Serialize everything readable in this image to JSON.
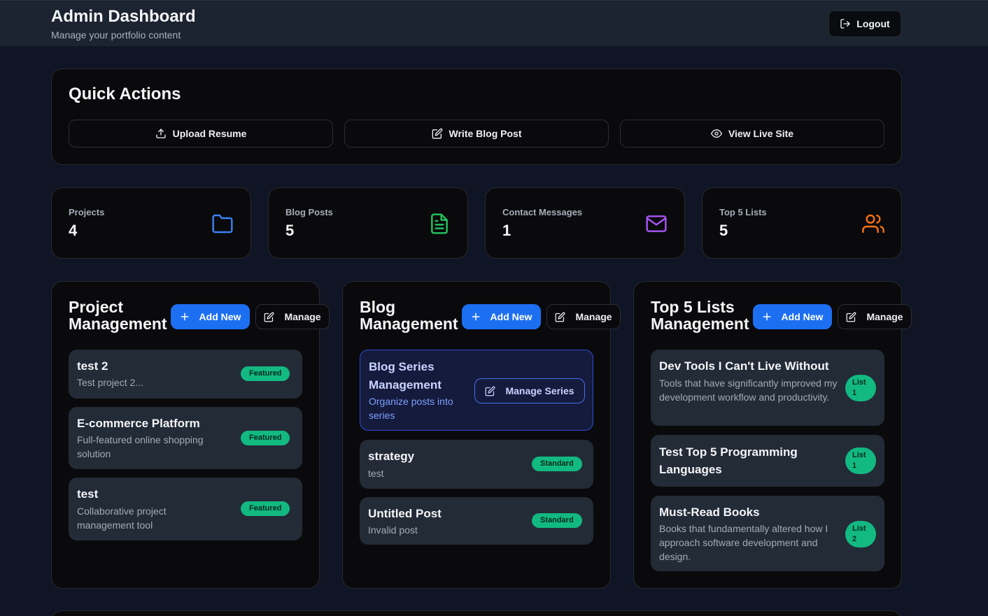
{
  "header": {
    "title": "Admin Dashboard",
    "subtitle": "Manage your portfolio content",
    "logout_label": "Logout"
  },
  "quick_actions": {
    "title": "Quick Actions",
    "buttons": [
      {
        "label": "Upload Resume",
        "icon": "upload-icon"
      },
      {
        "label": "Write Blog Post",
        "icon": "edit-icon"
      },
      {
        "label": "View Live Site",
        "icon": "eye-icon"
      }
    ]
  },
  "stats": [
    {
      "label": "Projects",
      "value": "4",
      "icon": "folder-icon",
      "color": "#3b82f6"
    },
    {
      "label": "Blog Posts",
      "value": "5",
      "icon": "file-text-icon",
      "color": "#22c55e"
    },
    {
      "label": "Contact Messages",
      "value": "1",
      "icon": "mail-icon",
      "color": "#a855f7"
    },
    {
      "label": "Top 5 Lists",
      "value": "5",
      "icon": "users-icon",
      "color": "#f97316"
    }
  ],
  "panels": {
    "projects": {
      "title_line1": "Project",
      "title_line2": "Management",
      "add_label": "Add New",
      "manage_label": "Manage",
      "items": [
        {
          "title": "test 2",
          "desc": "Test project 2...",
          "badge": "Featured"
        },
        {
          "title": "E-commerce Platform",
          "desc": "Full-featured online shopping solution",
          "badge": "Featured"
        },
        {
          "title": "test",
          "desc": "Collaborative project management tool",
          "badge": "Featured"
        }
      ]
    },
    "blog": {
      "title_line1": "Blog",
      "title_line2": "Management",
      "add_label": "Add New",
      "manage_label": "Manage",
      "series": {
        "title": "Blog Series Management",
        "desc": "Organize posts into series",
        "button": "Manage Series"
      },
      "items": [
        {
          "title": "strategy",
          "desc": "test",
          "badge": "Standard"
        },
        {
          "title": "Untitled Post",
          "desc": "Invalid post",
          "badge": "Standard"
        }
      ]
    },
    "lists": {
      "title_line1": "Top 5 Lists",
      "title_line2": "Management",
      "add_label": "Add New",
      "manage_label": "Manage",
      "items": [
        {
          "title": "Dev Tools I Can't Live Without",
          "desc": "Tools that have significantly improved my development workflow and productivity.",
          "badge_line1": "List",
          "badge_line2": "1"
        },
        {
          "title": "Test Top 5 Programming Languages",
          "desc": "",
          "badge_line1": "List",
          "badge_line2": "1"
        },
        {
          "title": "Must-Read Books",
          "desc": "Books that fundamentally altered how I approach software development and design.",
          "badge_line1": "List",
          "badge_line2": "2"
        }
      ]
    }
  },
  "colors": {
    "accent_blue": "#1d6ff2",
    "badge_green": "#12b981",
    "series_border": "#2e4bd6"
  }
}
